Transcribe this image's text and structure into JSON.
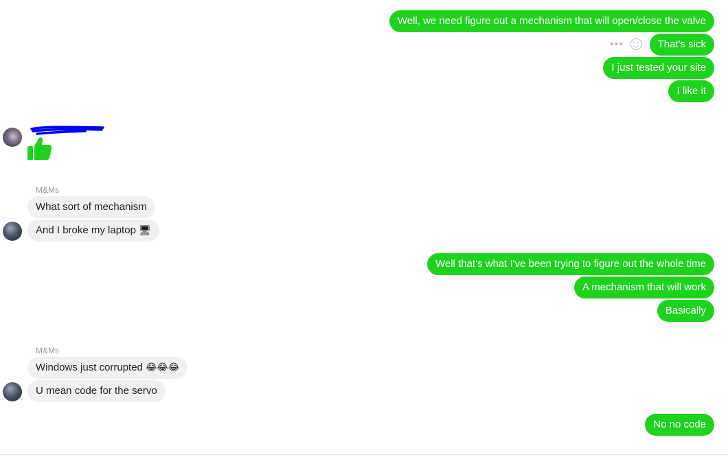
{
  "messages": {
    "out1": "Well, we need figure out a mechanism that will open/close the valve",
    "out2": "That's sick",
    "out3": "I just tested your site",
    "out4": "I like it",
    "in_sender1": "M&Ms",
    "in1": "What sort of mechanism",
    "in2_text": "And I broke my laptop",
    "in2_emoji": "🖥",
    "out5": "Well that's what I've been trying to figure out the whole time",
    "out6": "A mechanism that will work",
    "out7": "Basically",
    "in_sender2": "M&Ms",
    "in3_text": "Windows just corrupted",
    "in3_emoji": "😂😂😂",
    "in4": "U mean code for the servo",
    "out8": "No no code"
  },
  "hover_actions": {
    "more_icon": "more-dots-icon",
    "react_icon": "smiley-icon"
  },
  "colors": {
    "outgoing_bubble": "#1ed21e",
    "incoming_bubble": "#f1f0f0",
    "redaction": "#0000ff",
    "thumbs_up": "#1ed21e"
  }
}
